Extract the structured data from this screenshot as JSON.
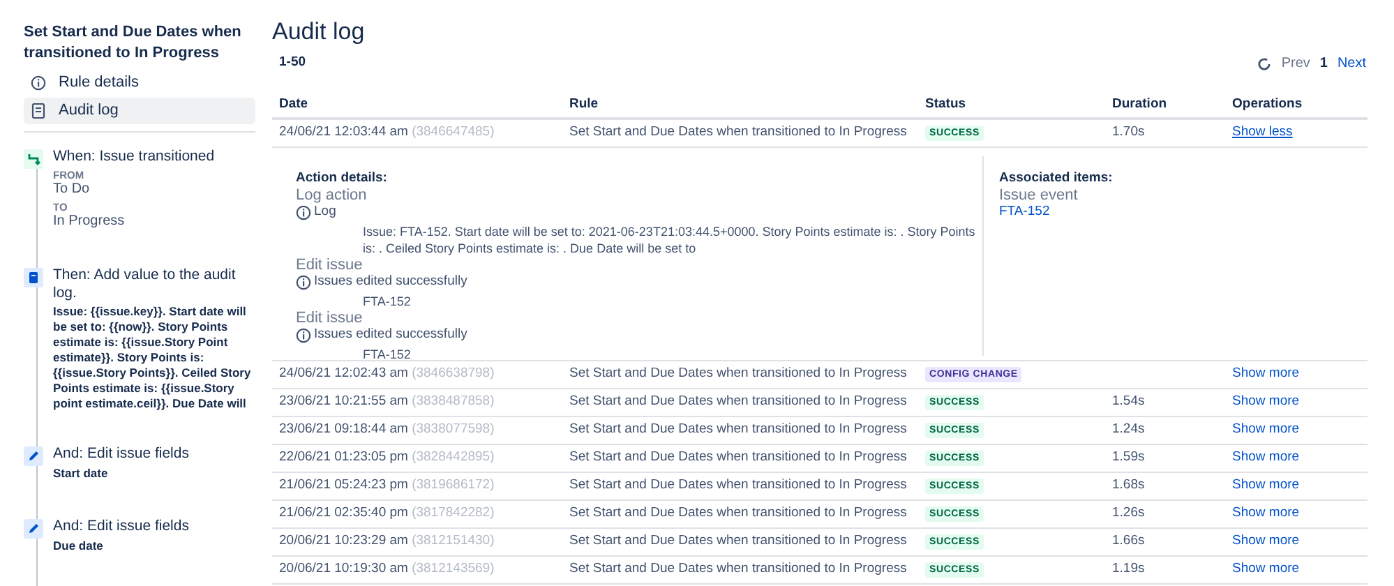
{
  "rule": {
    "title": "Set Start and Due Dates when transitioned to In Progress",
    "nav": [
      {
        "label": "Rule details",
        "selected": false
      },
      {
        "label": "Audit log",
        "selected": true
      }
    ],
    "components": [
      {
        "kind": "trigger",
        "title": "When: Issue transitioned",
        "fields": [
          {
            "label": "FROM",
            "value": "To Do"
          },
          {
            "label": "TO",
            "value": "In Progress"
          }
        ]
      },
      {
        "kind": "action_log",
        "title": "Then: Add value to the audit log.",
        "detail": "Issue: {{issue.key}}. Start date will be set to: {{now}}. Story Points estimate is: {{issue.Story Point estimate}}. Story Points is: {{issue.Story Points}}. Ceiled Story Points estimate is: {{issue.Story point estimate.ceil}}. Due Date will"
      },
      {
        "kind": "action_edit",
        "title": "And: Edit issue fields",
        "detail": "Start date"
      },
      {
        "kind": "action_edit",
        "title": "And: Edit issue fields",
        "detail": "Due date"
      }
    ]
  },
  "audit": {
    "title": "Audit log",
    "range": "1-50",
    "pagination": {
      "prev": "Prev",
      "page": "1",
      "next": "Next"
    },
    "columns": [
      "Date",
      "Rule",
      "Status",
      "Duration",
      "Operations"
    ],
    "rows": [
      {
        "date": "24/06/21 12:03:44 am",
        "id": "(3846647485)",
        "rule": "Set Start and Due Dates when transitioned to In Progress",
        "status": "SUCCESS",
        "kind": "success",
        "duration": "1.70s",
        "operation": "Show less",
        "expanded": true,
        "details": {
          "heading": "Action details:",
          "actions": [
            {
              "title": "Log action",
              "message": "Log",
              "detail": "Issue: FTA-152. Start date will be set to: 2021-06-23T21:03:44.5+0000. Story Points estimate is: . Story Points is: . Ceiled Story Points estimate is: . Due Date will be set to"
            },
            {
              "title": "Edit issue",
              "message": "Issues edited successfully",
              "detail": "FTA-152"
            },
            {
              "title": "Edit issue",
              "message": "Issues edited successfully",
              "detail": "FTA-152"
            }
          ],
          "associated_heading": "Associated items:",
          "associated_type": "Issue event",
          "associated_link": "FTA-152"
        }
      },
      {
        "date": "24/06/21 12:02:43 am",
        "id": "(3846638798)",
        "rule": "Set Start and Due Dates when transitioned to In Progress",
        "status": "CONFIG CHANGE",
        "kind": "config",
        "operation": "Show more",
        "expanded": false
      },
      {
        "date": "23/06/21 10:21:55 am",
        "id": "(3838487858)",
        "rule": "Set Start and Due Dates when transitioned to In Progress",
        "status": "SUCCESS",
        "kind": "success",
        "duration": "1.54s",
        "operation": "Show more",
        "expanded": false
      },
      {
        "date": "23/06/21 09:18:44 am",
        "id": "(3838077598)",
        "rule": "Set Start and Due Dates when transitioned to In Progress",
        "status": "SUCCESS",
        "kind": "success",
        "duration": "1.24s",
        "operation": "Show more",
        "expanded": false
      },
      {
        "date": "22/06/21 01:23:05 pm",
        "id": "(3828442895)",
        "rule": "Set Start and Due Dates when transitioned to In Progress",
        "status": "SUCCESS",
        "kind": "success",
        "duration": "1.59s",
        "operation": "Show more",
        "expanded": false
      },
      {
        "date": "21/06/21 05:24:23 pm",
        "id": "(3819686172)",
        "rule": "Set Start and Due Dates when transitioned to In Progress",
        "status": "SUCCESS",
        "kind": "success",
        "duration": "1.68s",
        "operation": "Show more",
        "expanded": false
      },
      {
        "date": "21/06/21 02:35:40 pm",
        "id": "(3817842282)",
        "rule": "Set Start and Due Dates when transitioned to In Progress",
        "status": "SUCCESS",
        "kind": "success",
        "duration": "1.26s",
        "operation": "Show more",
        "expanded": false
      },
      {
        "date": "20/06/21 10:23:29 am",
        "id": "(3812151430)",
        "rule": "Set Start and Due Dates when transitioned to In Progress",
        "status": "SUCCESS",
        "kind": "success",
        "duration": "1.66s",
        "operation": "Show more",
        "expanded": false
      },
      {
        "date": "20/06/21 10:19:30 am",
        "id": "(3812143569)",
        "rule": "Set Start and Due Dates when transitioned to In Progress",
        "status": "SUCCESS",
        "kind": "success",
        "duration": "1.19s",
        "operation": "Show more",
        "expanded": false
      }
    ]
  }
}
